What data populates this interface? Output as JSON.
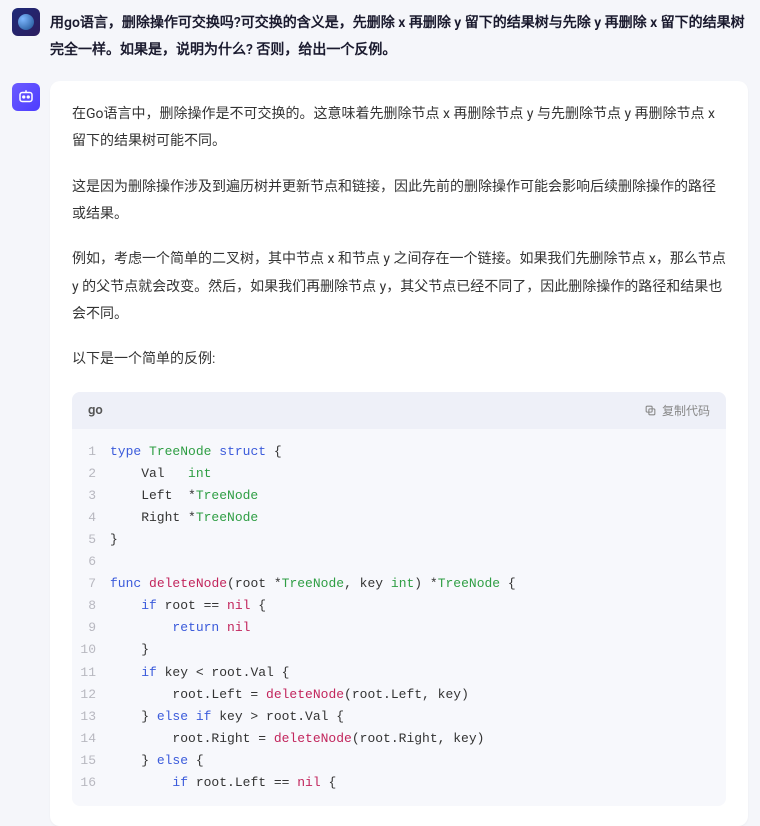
{
  "question": "用go语言，删除操作可交换吗?可交换的含义是，先删除 x 再删除 y 留下的结果树与先除 y 再删除 x 留下的结果树完全一样。如果是，说明为什么? 否则，给出一个反例。",
  "answer": {
    "p1": "在Go语言中，删除操作是不可交换的。这意味着先删除节点 x 再删除节点 y 与先删除节点 y 再删除节点 x 留下的结果树可能不同。",
    "p2": "这是因为删除操作涉及到遍历树并更新节点和链接，因此先前的删除操作可能会影响后续删除操作的路径或结果。",
    "p3": "例如，考虑一个简单的二叉树，其中节点 x 和节点 y 之间存在一个链接。如果我们先删除节点 x，那么节点 y 的父节点就会改变。然后，如果我们再删除节点 y，其父节点已经不同了，因此删除操作的路径和结果也会不同。",
    "p4": "以下是一个简单的反例:"
  },
  "code": {
    "lang": "go",
    "copy_label": "复制代码",
    "lines": [
      {
        "n": "1",
        "html": "<span class='kw'>type</span> <span class='typ'>TreeNode</span> <span class='kw'>struct</span> {"
      },
      {
        "n": "2",
        "html": "    Val   <span class='typ'>int</span>"
      },
      {
        "n": "3",
        "html": "    Left  *<span class='typ'>TreeNode</span>"
      },
      {
        "n": "4",
        "html": "    Right *<span class='typ'>TreeNode</span>"
      },
      {
        "n": "5",
        "html": "}"
      },
      {
        "n": "6",
        "html": ""
      },
      {
        "n": "7",
        "html": "<span class='kw'>func</span> <span class='fn'>deleteNode</span>(root *<span class='typ'>TreeNode</span>, key <span class='typ'>int</span>) *<span class='typ'>TreeNode</span> {"
      },
      {
        "n": "8",
        "html": "    <span class='kw'>if</span> root == <span class='nil'>nil</span> {"
      },
      {
        "n": "9",
        "html": "        <span class='kw'>return</span> <span class='nil'>nil</span>"
      },
      {
        "n": "10",
        "html": "    }"
      },
      {
        "n": "11",
        "html": "    <span class='kw'>if</span> key &lt; root.Val {"
      },
      {
        "n": "12",
        "html": "        root.Left = <span class='fn'>deleteNode</span>(root.Left, key)"
      },
      {
        "n": "13",
        "html": "    } <span class='kw'>else if</span> key &gt; root.Val {"
      },
      {
        "n": "14",
        "html": "        root.Right = <span class='fn'>deleteNode</span>(root.Right, key)"
      },
      {
        "n": "15",
        "html": "    } <span class='kw'>else</span> {"
      },
      {
        "n": "16",
        "html": "        <span class='kw'>if</span> root.Left == <span class='nil'>nil</span> {"
      }
    ]
  }
}
